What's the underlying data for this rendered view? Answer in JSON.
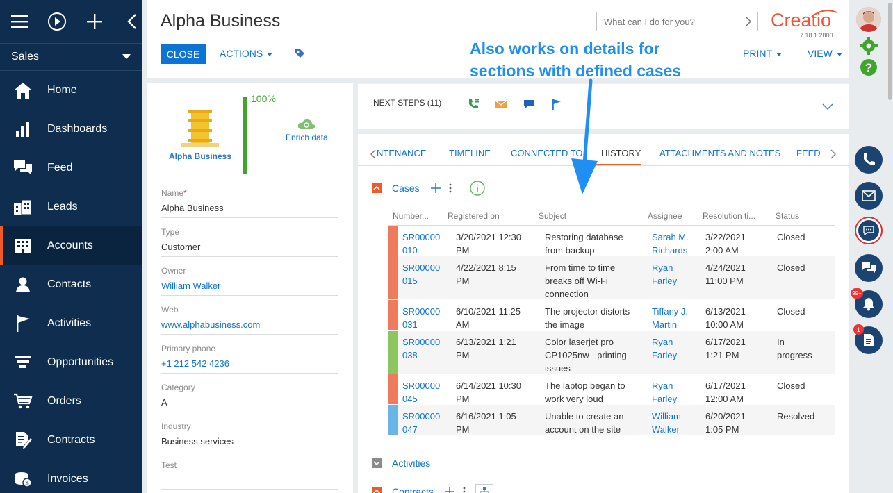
{
  "nav": {
    "workspace": "Sales",
    "items": [
      {
        "label": "Home",
        "icon": "home-icon"
      },
      {
        "label": "Dashboards",
        "icon": "dashboards-icon"
      },
      {
        "label": "Feed",
        "icon": "feed-icon"
      },
      {
        "label": "Leads",
        "icon": "leads-icon"
      },
      {
        "label": "Accounts",
        "icon": "accounts-icon",
        "active": true
      },
      {
        "label": "Contacts",
        "icon": "contacts-icon"
      },
      {
        "label": "Activities",
        "icon": "activities-icon"
      },
      {
        "label": "Opportunities",
        "icon": "opportunities-icon"
      },
      {
        "label": "Orders",
        "icon": "orders-icon"
      },
      {
        "label": "Contracts",
        "icon": "contracts-icon"
      },
      {
        "label": "Invoices",
        "icon": "invoices-icon"
      }
    ]
  },
  "header": {
    "title": "Alpha Business",
    "close_label": "CLOSE",
    "actions_label": "ACTIONS",
    "search_placeholder": "What can I do for you?",
    "logo": "Creatio",
    "version": "7.18.1.2800",
    "print_label": "PRINT",
    "view_label": "VIEW"
  },
  "profile": {
    "logo_text": "Alpha Business",
    "completeness": "100%",
    "completeness_fraction": 1.0,
    "enrich_label": "Enrich data",
    "fields": [
      {
        "label": "Name",
        "value": "Alpha Business",
        "required": true,
        "link": false
      },
      {
        "label": "Type",
        "value": "Customer",
        "link": false
      },
      {
        "label": "Owner",
        "value": "William Walker",
        "link": true
      },
      {
        "label": "Web",
        "value": "www.alphabusiness.com",
        "link": true
      },
      {
        "label": "Primary phone",
        "value": "+1 212 542 4236",
        "link": true
      },
      {
        "label": "Category",
        "value": "A",
        "link": false
      },
      {
        "label": "Industry",
        "value": "Business services",
        "link": false
      },
      {
        "label": "Test",
        "value": "",
        "link": false
      }
    ]
  },
  "next_steps": {
    "title": "NEXT STEPS (11)"
  },
  "tabs": [
    "INTENANCE",
    "TIMELINE",
    "CONNECTED TO",
    "HISTORY",
    "ATTACHMENTS AND NOTES",
    "FEED"
  ],
  "tabs_display": [
    "NTENANCE",
    "TIMELINE",
    "CONNECTED TO",
    "HISTORY",
    "ATTACHMENTS AND NOTES",
    "FEED"
  ],
  "active_tab": "HISTORY",
  "cases": {
    "title": "Cases",
    "columns": [
      "Number...",
      "Registered on",
      "Subject",
      "Assignee",
      "Resolution ti...",
      "Status"
    ],
    "rows": [
      {
        "number": [
          "SR00000",
          "010"
        ],
        "registered": [
          "3/20/2021 12:30",
          "PM"
        ],
        "subject": [
          "Restoring database",
          "from backup"
        ],
        "assignee": [
          "Sarah M.",
          "Richards"
        ],
        "resolution": [
          "3/22/2021",
          "2:00 AM"
        ],
        "status": [
          "Closed"
        ],
        "color": "#ee7b5e"
      },
      {
        "number": [
          "SR00000",
          "015"
        ],
        "registered": [
          "4/22/2021 8:15",
          "PM"
        ],
        "subject": [
          "From time to time",
          "breaks off Wi-Fi",
          "connection"
        ],
        "assignee": [
          "Ryan",
          "Farley"
        ],
        "resolution": [
          "4/24/2021",
          "11:00 PM"
        ],
        "status": [
          "Closed"
        ],
        "color": "#ee7b5e"
      },
      {
        "number": [
          "SR00000",
          "031"
        ],
        "registered": [
          "6/10/2021 11:25",
          "AM"
        ],
        "subject": [
          "The projector distorts",
          "the image"
        ],
        "assignee": [
          "Tiffany J.",
          "Martin"
        ],
        "resolution": [
          "6/13/2021",
          "10:00 AM"
        ],
        "status": [
          "Closed"
        ],
        "color": "#ee7b5e"
      },
      {
        "number": [
          "SR00000",
          "038"
        ],
        "registered": [
          "6/13/2021 1:21",
          "PM"
        ],
        "subject": [
          "Color laserjet pro",
          "CP1025nw - printing",
          "issues"
        ],
        "assignee": [
          "Ryan",
          "Farley"
        ],
        "resolution": [
          "6/17/2021",
          "1:21 PM"
        ],
        "status": [
          "In",
          "progress"
        ],
        "color": "#8dc560"
      },
      {
        "number": [
          "SR00000",
          "045"
        ],
        "registered": [
          "6/14/2021 10:30",
          "PM"
        ],
        "subject": [
          "The laptop began to",
          "work very loud"
        ],
        "assignee": [
          "Ryan",
          "Farley"
        ],
        "resolution": [
          "6/17/2021",
          "12:00 AM"
        ],
        "status": [
          "Closed"
        ],
        "color": "#ee7b5e"
      },
      {
        "number": [
          "SR00000",
          "047"
        ],
        "registered": [
          "6/16/2021 1:05",
          "PM"
        ],
        "subject": [
          "Unable to create an",
          "account on the site"
        ],
        "assignee": [
          "William",
          "Walker"
        ],
        "resolution": [
          "6/20/2021",
          "1:05 PM"
        ],
        "status": [
          "Resolved"
        ],
        "color": "#69b5e5"
      }
    ]
  },
  "activities": {
    "title": "Activities"
  },
  "contracts": {
    "title": "Contracts"
  },
  "annotation": {
    "line1": "Also works on details for",
    "line2": "sections with defined cases"
  },
  "rightbar": {
    "notif_badge": "99+",
    "doc_badge": "1"
  },
  "colors": {
    "accent": "#0e74d4",
    "nav_bg": "#0f2d4f",
    "orange": "#f05a28",
    "brand": "#f4533a"
  }
}
